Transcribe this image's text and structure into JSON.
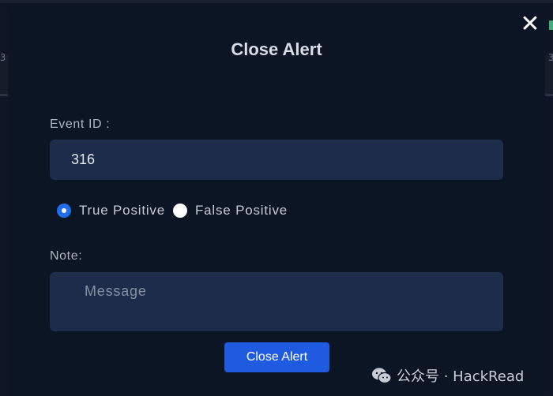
{
  "modal": {
    "title": "Close Alert",
    "close_glyph": "✕",
    "event_id_label": "Event ID :",
    "event_id_value": "316",
    "radio_options": [
      {
        "label": "True Positive",
        "selected": true
      },
      {
        "label": "False Positive",
        "selected": false
      }
    ],
    "note_label": "Note:",
    "note_placeholder": "Message",
    "submit_label": "Close Alert"
  },
  "background": {
    "left_glyph": "3",
    "right_glyph": "3"
  },
  "watermark": {
    "text": "公众号 · HackRead",
    "icon": "wechat-icon"
  },
  "colors": {
    "modal_bg": "#0c1524",
    "input_bg": "#1c2c4a",
    "accent": "#1f5be0",
    "radio_checked": "#1f6fe8"
  }
}
